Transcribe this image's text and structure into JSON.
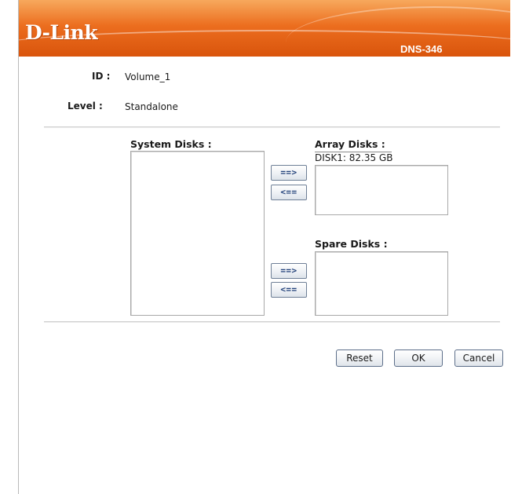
{
  "header": {
    "logo": "D-Link",
    "model": "DNS-346",
    "brand_color": "#ec6e1f"
  },
  "volume": {
    "id_label": "ID :",
    "id_value": "Volume_1",
    "level_label": "Level :",
    "level_value": "Standalone"
  },
  "disks": {
    "system_title": "System Disks :",
    "system_items": [],
    "array_title": "Array Disks :",
    "array_info": "DISK1: 82.35 GB",
    "array_items": [],
    "spare_title": "Spare Disks :",
    "spare_items": [],
    "add_label": "==>",
    "remove_label": "<=="
  },
  "buttons": {
    "reset": "Reset",
    "ok": "OK",
    "cancel": "Cancel"
  }
}
